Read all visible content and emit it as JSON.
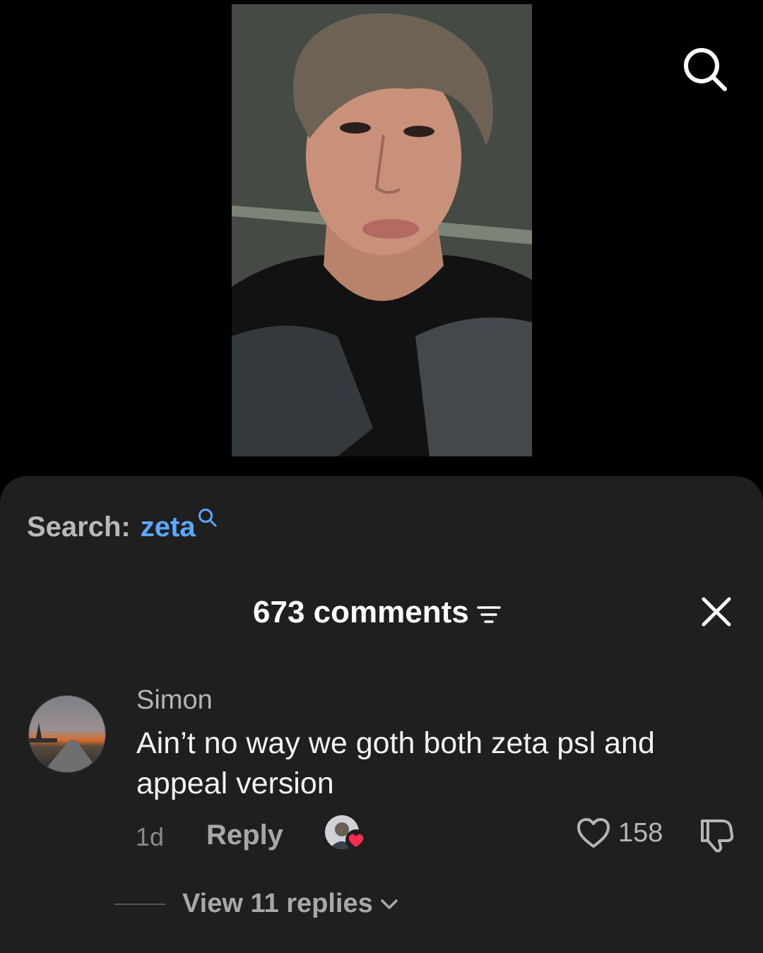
{
  "video": {
    "description_icon": "video-thumbnail"
  },
  "topbar": {
    "search_icon": "search-icon"
  },
  "sheet": {
    "search": {
      "prefix": "Search:",
      "term": "zeta",
      "icon": "search-icon"
    },
    "comments_header": {
      "title": "673 comments",
      "filter_icon": "filter-icon",
      "close_icon": "close-icon"
    },
    "comment": {
      "username": "Simon",
      "text": "Ain’t no way we goth both zeta psl and appeal version",
      "time": "1d",
      "reply_label": "Reply",
      "like_count": "158",
      "liked_by_creator": true,
      "view_replies_label": "View 11 replies"
    }
  },
  "colors": {
    "accent": "#5aa8ff",
    "sheet_bg": "#1f1f1f",
    "heart_red": "#fe2c55"
  }
}
